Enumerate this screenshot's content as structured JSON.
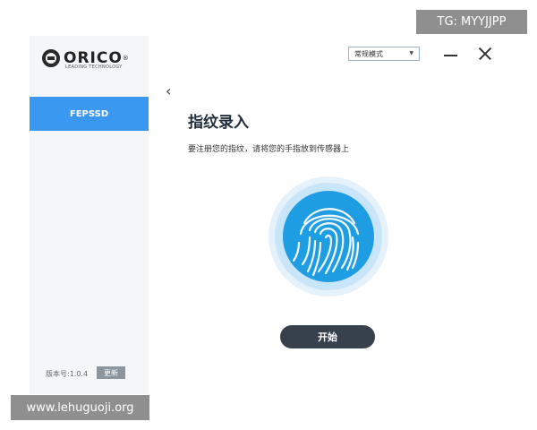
{
  "brand": {
    "name": "ORICO",
    "registered": "®",
    "tagline": "LEADING TECHNOLOGY"
  },
  "sidebar": {
    "items": [
      {
        "label": "FEPSSD",
        "active": true
      }
    ],
    "version_label": "版本号:1.0.4",
    "update_label": "更新"
  },
  "header": {
    "mode_select": {
      "value": "常规模式",
      "icon": "chevron-down-icon"
    },
    "window_controls": [
      "minimize-icon",
      "close-icon"
    ]
  },
  "main": {
    "back_icon": "chevron-left-icon",
    "title": "指纹录入",
    "instruction": "要注册您的指纹，请将您的手指放到传感器上",
    "fingerprint_icon": "fingerprint-icon",
    "start_label": "开始"
  },
  "overlays": {
    "tg": "TG: MYYJJPP",
    "site": "www.lehuguoji.org"
  },
  "colors": {
    "accent": "#3b98f0",
    "fingerprint": "#1f9de3",
    "button_dark": "#36414d",
    "sidebar_bg": "#f4f6f8"
  }
}
